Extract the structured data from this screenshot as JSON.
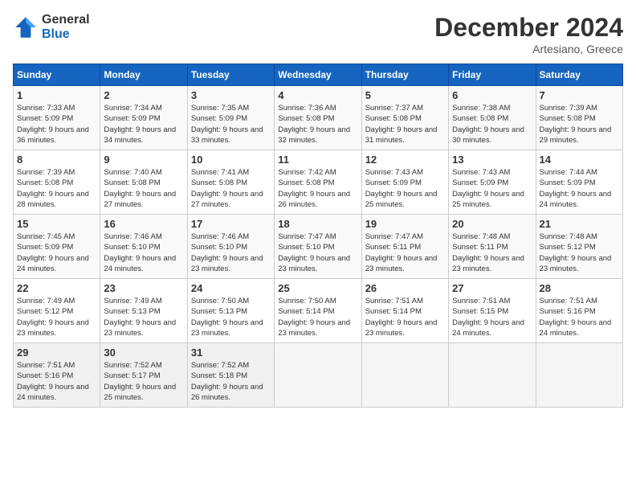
{
  "header": {
    "logo": {
      "general": "General",
      "blue": "Blue"
    },
    "title": "December 2024",
    "location": "Artesiano, Greece"
  },
  "weekdays": [
    "Sunday",
    "Monday",
    "Tuesday",
    "Wednesday",
    "Thursday",
    "Friday",
    "Saturday"
  ],
  "weeks": [
    [
      {
        "day": "1",
        "sunrise": "7:33 AM",
        "sunset": "5:09 PM",
        "daylight": "9 hours and 36 minutes."
      },
      {
        "day": "2",
        "sunrise": "7:34 AM",
        "sunset": "5:09 PM",
        "daylight": "9 hours and 34 minutes."
      },
      {
        "day": "3",
        "sunrise": "7:35 AM",
        "sunset": "5:09 PM",
        "daylight": "9 hours and 33 minutes."
      },
      {
        "day": "4",
        "sunrise": "7:36 AM",
        "sunset": "5:08 PM",
        "daylight": "9 hours and 32 minutes."
      },
      {
        "day": "5",
        "sunrise": "7:37 AM",
        "sunset": "5:08 PM",
        "daylight": "9 hours and 31 minutes."
      },
      {
        "day": "6",
        "sunrise": "7:38 AM",
        "sunset": "5:08 PM",
        "daylight": "9 hours and 30 minutes."
      },
      {
        "day": "7",
        "sunrise": "7:39 AM",
        "sunset": "5:08 PM",
        "daylight": "9 hours and 29 minutes."
      }
    ],
    [
      {
        "day": "8",
        "sunrise": "7:39 AM",
        "sunset": "5:08 PM",
        "daylight": "9 hours and 28 minutes."
      },
      {
        "day": "9",
        "sunrise": "7:40 AM",
        "sunset": "5:08 PM",
        "daylight": "9 hours and 27 minutes."
      },
      {
        "day": "10",
        "sunrise": "7:41 AM",
        "sunset": "5:08 PM",
        "daylight": "9 hours and 27 minutes."
      },
      {
        "day": "11",
        "sunrise": "7:42 AM",
        "sunset": "5:08 PM",
        "daylight": "9 hours and 26 minutes."
      },
      {
        "day": "12",
        "sunrise": "7:43 AM",
        "sunset": "5:09 PM",
        "daylight": "9 hours and 25 minutes."
      },
      {
        "day": "13",
        "sunrise": "7:43 AM",
        "sunset": "5:09 PM",
        "daylight": "9 hours and 25 minutes."
      },
      {
        "day": "14",
        "sunrise": "7:44 AM",
        "sunset": "5:09 PM",
        "daylight": "9 hours and 24 minutes."
      }
    ],
    [
      {
        "day": "15",
        "sunrise": "7:45 AM",
        "sunset": "5:09 PM",
        "daylight": "9 hours and 24 minutes."
      },
      {
        "day": "16",
        "sunrise": "7:46 AM",
        "sunset": "5:10 PM",
        "daylight": "9 hours and 24 minutes."
      },
      {
        "day": "17",
        "sunrise": "7:46 AM",
        "sunset": "5:10 PM",
        "daylight": "9 hours and 23 minutes."
      },
      {
        "day": "18",
        "sunrise": "7:47 AM",
        "sunset": "5:10 PM",
        "daylight": "9 hours and 23 minutes."
      },
      {
        "day": "19",
        "sunrise": "7:47 AM",
        "sunset": "5:11 PM",
        "daylight": "9 hours and 23 minutes."
      },
      {
        "day": "20",
        "sunrise": "7:48 AM",
        "sunset": "5:11 PM",
        "daylight": "9 hours and 23 minutes."
      },
      {
        "day": "21",
        "sunrise": "7:48 AM",
        "sunset": "5:12 PM",
        "daylight": "9 hours and 23 minutes."
      }
    ],
    [
      {
        "day": "22",
        "sunrise": "7:49 AM",
        "sunset": "5:12 PM",
        "daylight": "9 hours and 23 minutes."
      },
      {
        "day": "23",
        "sunrise": "7:49 AM",
        "sunset": "5:13 PM",
        "daylight": "9 hours and 23 minutes."
      },
      {
        "day": "24",
        "sunrise": "7:50 AM",
        "sunset": "5:13 PM",
        "daylight": "9 hours and 23 minutes."
      },
      {
        "day": "25",
        "sunrise": "7:50 AM",
        "sunset": "5:14 PM",
        "daylight": "9 hours and 23 minutes."
      },
      {
        "day": "26",
        "sunrise": "7:51 AM",
        "sunset": "5:14 PM",
        "daylight": "9 hours and 23 minutes."
      },
      {
        "day": "27",
        "sunrise": "7:51 AM",
        "sunset": "5:15 PM",
        "daylight": "9 hours and 24 minutes."
      },
      {
        "day": "28",
        "sunrise": "7:51 AM",
        "sunset": "5:16 PM",
        "daylight": "9 hours and 24 minutes."
      }
    ],
    [
      {
        "day": "29",
        "sunrise": "7:51 AM",
        "sunset": "5:16 PM",
        "daylight": "9 hours and 24 minutes."
      },
      {
        "day": "30",
        "sunrise": "7:52 AM",
        "sunset": "5:17 PM",
        "daylight": "9 hours and 25 minutes."
      },
      {
        "day": "31",
        "sunrise": "7:52 AM",
        "sunset": "5:18 PM",
        "daylight": "9 hours and 26 minutes."
      },
      null,
      null,
      null,
      null
    ]
  ]
}
